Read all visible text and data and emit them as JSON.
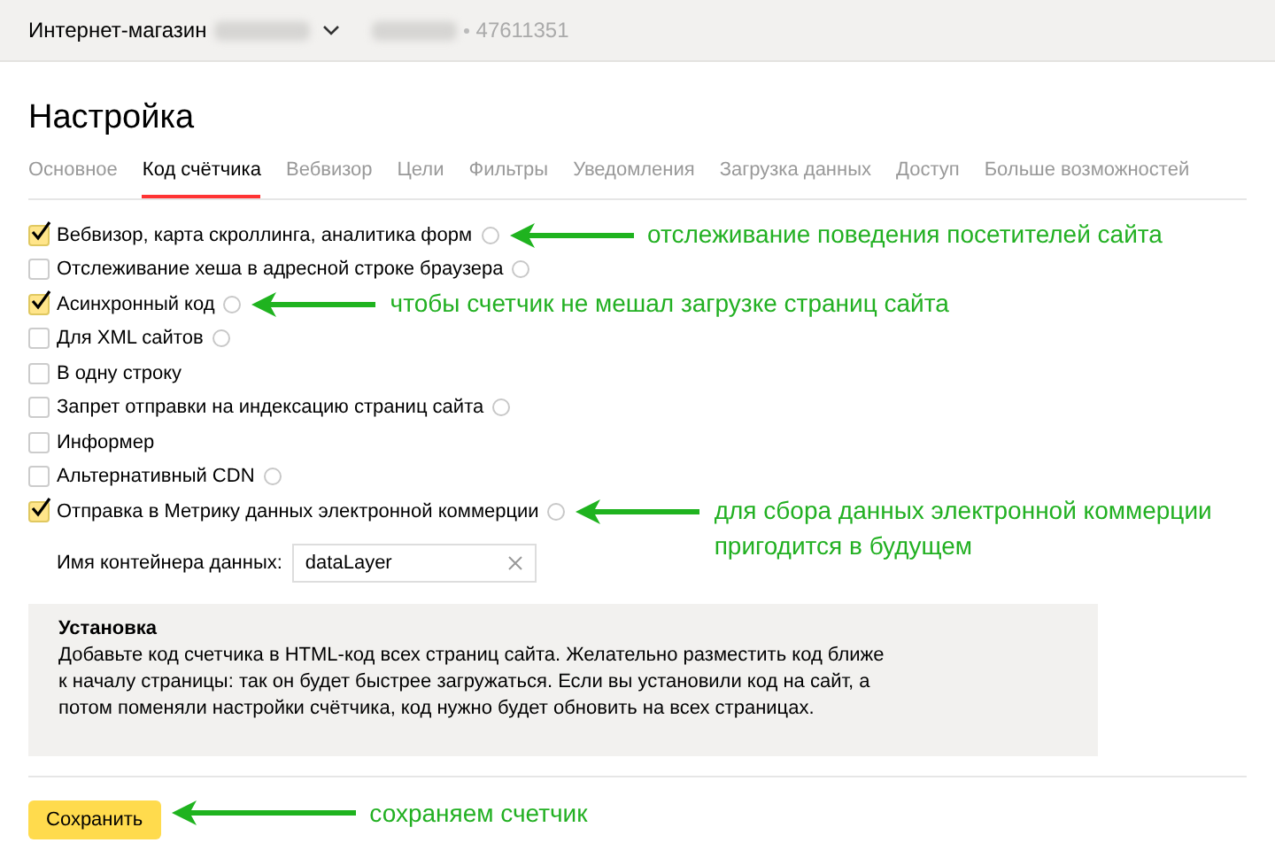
{
  "header": {
    "site_name": "Интернет-магазин",
    "counter_id": "47611351"
  },
  "page_title": "Настройка",
  "tabs": [
    {
      "label": "Основное",
      "selected": false
    },
    {
      "label": "Код счётчика",
      "selected": true
    },
    {
      "label": "Вебвизор",
      "selected": false
    },
    {
      "label": "Цели",
      "selected": false
    },
    {
      "label": "Фильтры",
      "selected": false
    },
    {
      "label": "Уведомления",
      "selected": false
    },
    {
      "label": "Загрузка данных",
      "selected": false
    },
    {
      "label": "Доступ",
      "selected": false
    },
    {
      "label": "Больше возможностей",
      "selected": false
    }
  ],
  "options": [
    {
      "label": "Вебвизор, карта скроллинга, аналитика форм",
      "checked": true,
      "help": true,
      "annotation": [
        "отслеживание поведения посетителей сайта"
      ]
    },
    {
      "label": "Отслеживание хеша в адресной строке браузера",
      "checked": false,
      "help": true
    },
    {
      "label": "Асинхронный код",
      "checked": true,
      "help": true,
      "annotation": [
        "чтобы счетчик не мешал загрузке страниц сайта"
      ]
    },
    {
      "label": "Для XML сайтов",
      "checked": false,
      "help": true
    },
    {
      "label": "В одну строку",
      "checked": false,
      "help": false
    },
    {
      "label": "Запрет отправки на индексацию страниц сайта",
      "checked": false,
      "help": true
    },
    {
      "label": "Информер",
      "checked": false,
      "help": false
    },
    {
      "label": "Альтернативный CDN",
      "checked": false,
      "help": true
    },
    {
      "label": "Отправка в Метрику данных электронной коммерции",
      "checked": true,
      "help": true,
      "annotation": [
        "для сбора данных электронной коммерции",
        "пригодится в будущем"
      ]
    }
  ],
  "container_field": {
    "label": "Имя контейнера данных:",
    "value": "dataLayer"
  },
  "install_note": {
    "title": "Установка",
    "text": "Добавьте код счетчика в HTML-код всех страниц сайта. Желательно разместить код ближе к началу страницы: так он будет быстрее загружаться. Если вы установили код на сайт, а потом поменяли настройки счётчика, код нужно будет обновить на всех страницах."
  },
  "save_button": {
    "label": "Сохранить",
    "annotation": [
      "сохраняем счетчик"
    ]
  }
}
